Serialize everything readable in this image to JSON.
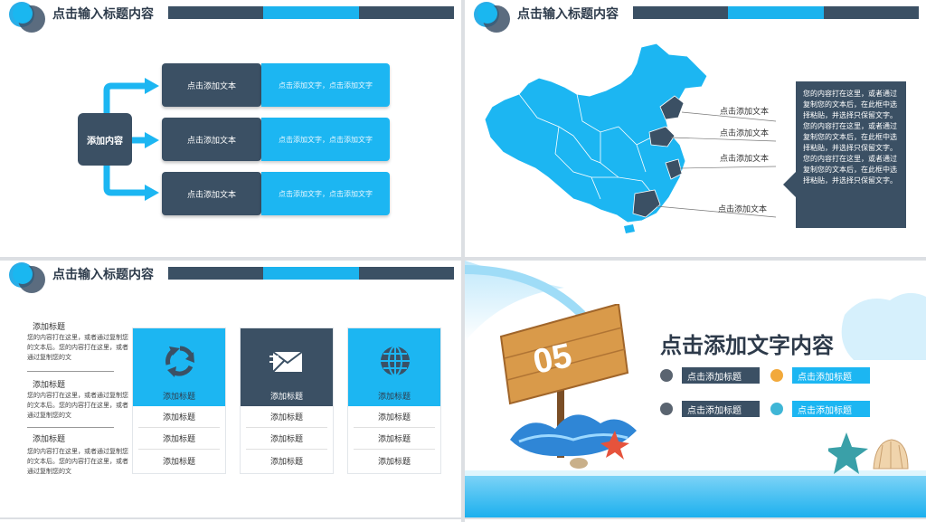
{
  "header_title": "点击输入标题内容",
  "slide1": {
    "center": "添加内容",
    "rows": [
      {
        "left": "点击添加文本",
        "right": "点击添加文字，点击添加文字"
      },
      {
        "left": "点击添加文本",
        "right": "点击添加文字，点击添加文字"
      },
      {
        "left": "点击添加文本",
        "right": "点击添加文字，点击添加文字"
      }
    ]
  },
  "slide2": {
    "labels": [
      "点击添加文本",
      "点击添加文本",
      "点击添加文本",
      "点击添加文本"
    ],
    "info": "您的内容打在这里，或者通过复制您的文本后，在此框中选择粘贴，并选择只保留文字。您的内容打在这里，或者通过复制您的文本后，在此框中选择粘贴，并选择只保留文字。您的内容打在这里，或者通过复制您的文本后，在此框中选择粘贴，并选择只保留文字。"
  },
  "slide3": {
    "side": [
      {
        "title": "添加标题",
        "text": "您的内容打在这里，或者通过复制您的文本后。您的内容打在这里，或者通过复制您的文"
      },
      {
        "title": "添加标题",
        "text": "您的内容打在这里，或者通过复制您的文本后。您的内容打在这里，或者通过复制您的文"
      },
      {
        "title": "添加标题",
        "text": "您的内容打在这里，或者通过复制您的文本后。您的内容打在这里，或者通过复制您的文"
      }
    ],
    "cards": [
      {
        "label": "添加标题",
        "icon": "recycle-icon",
        "color": "#1cb6f2",
        "rows": [
          "添加标题",
          "添加标题",
          "添加标题"
        ]
      },
      {
        "label": "添加标题",
        "icon": "mail-icon",
        "color": "#3b5064",
        "rows": [
          "添加标题",
          "添加标题",
          "添加标题"
        ]
      },
      {
        "label": "添加标题",
        "icon": "globe-icon",
        "color": "#1cb6f2",
        "rows": [
          "添加标题",
          "添加标题",
          "添加标题"
        ]
      }
    ]
  },
  "slide4": {
    "number": "05",
    "title": "点击添加文字内容",
    "items": [
      "点击添加标题",
      "点击添加标题",
      "点击添加标题",
      "点击添加标题"
    ]
  }
}
